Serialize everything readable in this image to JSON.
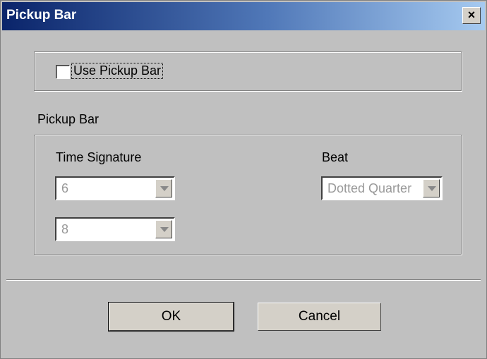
{
  "window": {
    "title": "Pickup Bar",
    "close_label": "×"
  },
  "use_pickup": {
    "label": "Use Pickup Bar",
    "checked": false
  },
  "pickup_group": {
    "label": "Pickup Bar"
  },
  "time_signature": {
    "label": "Time Signature",
    "numerator": "6",
    "denominator": "8"
  },
  "beat": {
    "label": "Beat",
    "value": "Dotted Quarter"
  },
  "buttons": {
    "ok": "OK",
    "cancel": "Cancel"
  }
}
